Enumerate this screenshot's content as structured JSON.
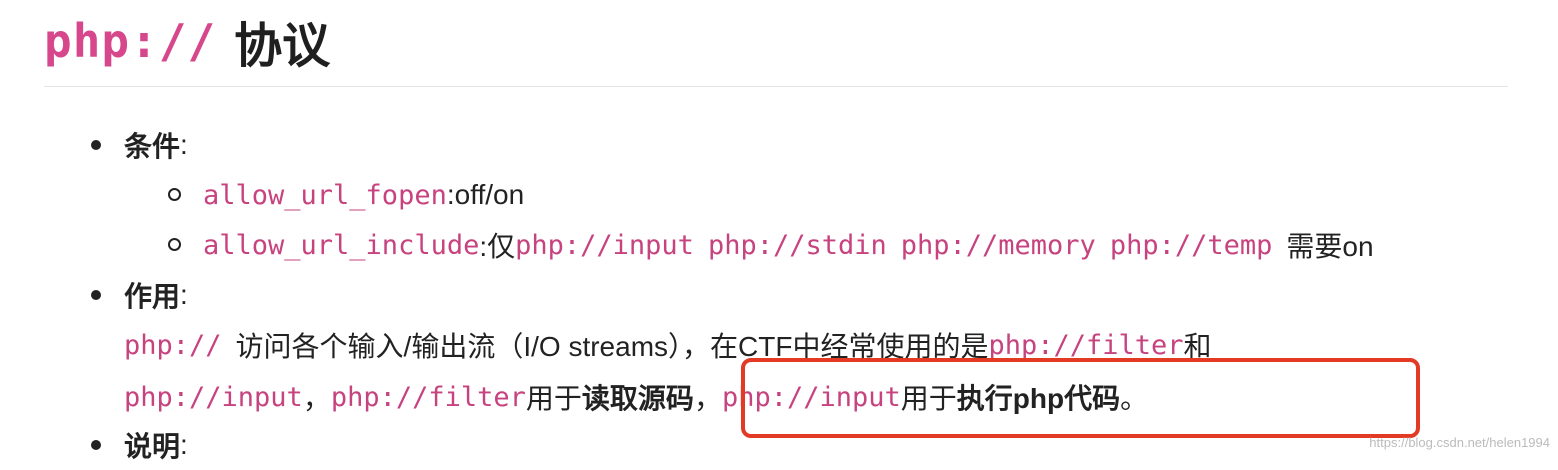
{
  "heading": {
    "code": "php://",
    "text": "协议"
  },
  "items": {
    "conditions": {
      "label": "条件",
      "colon": ":",
      "sub": [
        {
          "code": "allow_url_fopen",
          "text": ":off/on"
        },
        {
          "code": "allow_url_include",
          "text1": ":仅",
          "codes": [
            "php://input",
            "php://stdin",
            "php://memory",
            "php://temp"
          ],
          "text2": "需要on"
        }
      ]
    },
    "usage": {
      "label": "作用",
      "colon": ":",
      "line1": {
        "code1": "php://",
        "text1": "访问各个输入/输出流（I/O streams），在CTF中经常使用的是",
        "code2": "php://filter",
        "text2": "和"
      },
      "line2": {
        "code1": "php://input",
        "text1": "，",
        "code2": "php://filter",
        "text2": "用于",
        "bold1": "读取源码",
        "text3": "，",
        "code3": "php://input",
        "text4": "用于",
        "bold2": "执行php代码",
        "text5": "。"
      }
    },
    "notes": {
      "label": "说明",
      "colon": ":"
    }
  },
  "watermark": "https://blog.csdn.net/helen1994",
  "colors": {
    "code": "#c7437f",
    "heading_code": "#d6478b",
    "highlight_box": "#e33a26",
    "text": "#222222"
  }
}
